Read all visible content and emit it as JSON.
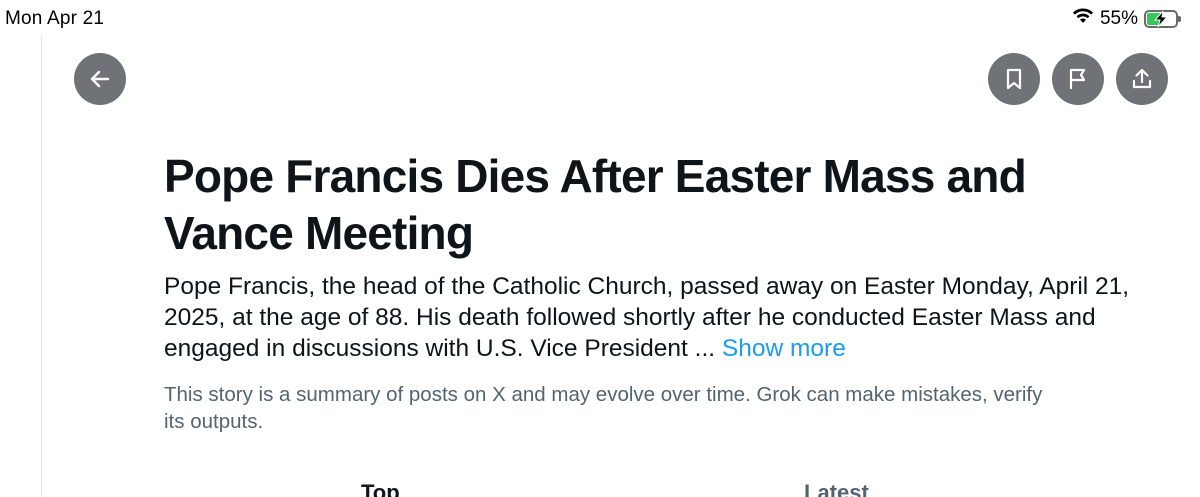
{
  "status_bar": {
    "time": "Mon Apr 21",
    "battery_percent": "55%",
    "battery_level": 0.55,
    "charging": true,
    "icons": [
      "wifi-icon",
      "battery-charging-icon"
    ]
  },
  "toolbar": {
    "back_icon": "arrow-left-icon",
    "bookmark_icon": "bookmark-icon",
    "flag_icon": "flag-icon",
    "share_icon": "share-icon"
  },
  "article": {
    "headline": "Pope Francis Dies After Easter Mass and Vance Meeting",
    "summary": "Pope Francis, the head of the Catholic Church, passed away on Easter Monday, April 21, 2025, at the age of 88. His death followed shortly after he conducted Easter Mass and engaged in discussions with U.S. Vice President ... ",
    "show_more_label": "Show more",
    "disclaimer": "This story is a summary of posts on X and may evolve over time. Grok can make mistakes, verify its outputs."
  },
  "tabs": [
    {
      "label": "Top",
      "active": true
    },
    {
      "label": "Latest",
      "active": false
    }
  ],
  "colors": {
    "accent": "#1d9bf0",
    "button_bg": "#6f7276",
    "secondary_text": "#536471",
    "battery_green": "#34c759"
  }
}
